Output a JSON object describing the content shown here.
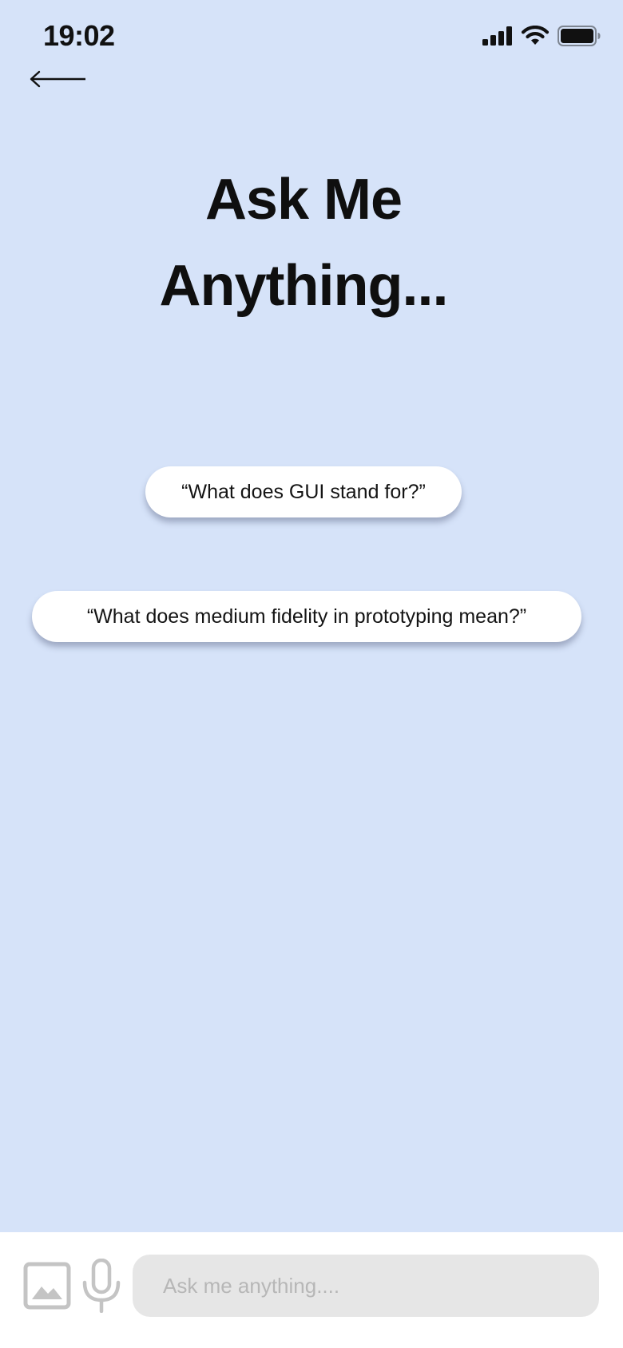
{
  "status_bar": {
    "time": "19:02",
    "icons": [
      "signal-icon",
      "wifi-icon",
      "battery-icon"
    ]
  },
  "nav": {
    "back_icon": "back-arrow-icon"
  },
  "hero": {
    "title_line1": "Ask Me",
    "title_line2": "Anything..."
  },
  "suggestions": [
    {
      "text": "“What does GUI stand for?”"
    },
    {
      "text": "“What does medium fidelity in prototyping mean?”"
    }
  ],
  "composer": {
    "placeholder": "Ask me anything....",
    "value": "",
    "image_icon": "image-icon",
    "mic_icon": "microphone-icon"
  },
  "colors": {
    "background": "#d6e3f9",
    "bubble": "#ffffff",
    "input_bg": "#e6e6e6",
    "icon_gray": "#c4c4c4",
    "text": "#111111"
  }
}
